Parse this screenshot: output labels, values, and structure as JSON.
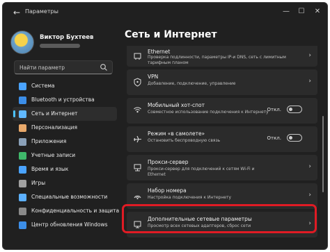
{
  "window": {
    "title": "Параметры"
  },
  "profile": {
    "name": "Виктор Бухтеев"
  },
  "search": {
    "placeholder": "Найти параметр"
  },
  "sidebar": {
    "items": [
      {
        "label": "Система",
        "icon": "monitor-icon",
        "color": "#4aa3ff"
      },
      {
        "label": "Bluetooth и устройства",
        "icon": "bluetooth-icon",
        "color": "#3c8ee8"
      },
      {
        "label": "Сеть и Интернет",
        "icon": "network-icon",
        "color": "#60b8ff",
        "active": true
      },
      {
        "label": "Персонализация",
        "icon": "brush-icon",
        "color": "#e8a86a"
      },
      {
        "label": "Приложения",
        "icon": "apps-icon",
        "color": "#8aa0b8"
      },
      {
        "label": "Учетные записи",
        "icon": "person-icon",
        "color": "#3fb86a"
      },
      {
        "label": "Время и язык",
        "icon": "globe-clock-icon",
        "color": "#4aa3ff"
      },
      {
        "label": "Игры",
        "icon": "gamepad-icon",
        "color": "#a0a0a0"
      },
      {
        "label": "Специальные возможности",
        "icon": "accessibility-icon",
        "color": "#5cb0ff"
      },
      {
        "label": "Конфиденциальность и защита",
        "icon": "shield-icon",
        "color": "#8a8a8a"
      },
      {
        "label": "Центр обновления Windows",
        "icon": "update-icon",
        "color": "#3c8ee8"
      }
    ]
  },
  "main": {
    "title": "Сеть и Интернет",
    "items": [
      {
        "title": "Ethernet",
        "desc": "Проверка подлинности, параметры IP-и DNS, сеть с лимитным тарифным планом",
        "icon": "ethernet-icon"
      },
      {
        "title": "VPN",
        "desc": "Добавление, подключение, управление",
        "icon": "vpn-shield-icon"
      },
      {
        "title": "Мобильный хот-спот",
        "desc": "Совместное использование подключения к Интернету",
        "icon": "hotspot-icon",
        "toggle": "Откл."
      },
      {
        "title": "Режим «в самолете»",
        "desc": "Остановить беспроводную связь",
        "icon": "airplane-icon",
        "toggle": "Откл."
      },
      {
        "title": "Прокси-сервер",
        "desc": "Прокси-сервер для подключений к сетям Wi-Fi и Ethernet",
        "icon": "proxy-icon"
      },
      {
        "title": "Набор номера",
        "desc": "Настройка подключения к Интернету",
        "icon": "dialup-icon"
      },
      {
        "title": "Дополнительные сетевые параметры",
        "desc": "Просмотр всех сетевых адаптеров, сброс сети",
        "icon": "advanced-network-icon"
      }
    ]
  },
  "colors": {
    "accent": "#4cc2ff",
    "highlight": "#e01b24",
    "background": "#202020",
    "card": "#2b2b2b"
  }
}
